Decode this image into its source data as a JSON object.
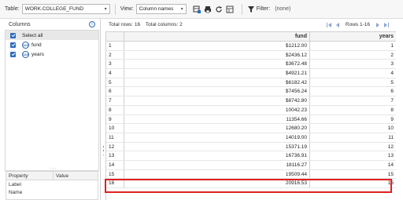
{
  "toolbar": {
    "table_label": "Table:",
    "table_value": "WORK.COLLEGE_FUND",
    "view_label": "View:",
    "view_value": "Column names",
    "filter_label": "Filter:",
    "filter_value": "(none)"
  },
  "columns_panel": {
    "title": "Columns",
    "select_all": "Select all",
    "items": [
      {
        "name": "fund"
      },
      {
        "name": "years"
      }
    ]
  },
  "properties_panel": {
    "col_property": "Property",
    "col_value": "Value",
    "rows": [
      "Label",
      "Name"
    ]
  },
  "grid_info": {
    "total_rows": "Total rows: 16",
    "total_columns": "Total columns: 2",
    "rows_range": "Rows 1-16"
  },
  "grid": {
    "headers": [
      "fund",
      "years"
    ],
    "rows": [
      [
        "1",
        "$1212.00",
        "1"
      ],
      [
        "2",
        "$2436.12",
        "2"
      ],
      [
        "3",
        "$3672.48",
        "3"
      ],
      [
        "4",
        "$4921.21",
        "4"
      ],
      [
        "5",
        "$6182.42",
        "5"
      ],
      [
        "6",
        "$7456.24",
        "6"
      ],
      [
        "7",
        "$8742.80",
        "7"
      ],
      [
        "8",
        "10042.23",
        "8"
      ],
      [
        "9",
        "11354.66",
        "9"
      ],
      [
        "10",
        "12680.20",
        "10"
      ],
      [
        "11",
        "14019.00",
        "11"
      ],
      [
        "12",
        "15371.19",
        "12"
      ],
      [
        "13",
        "16736.91",
        "13"
      ],
      [
        "14",
        "18116.27",
        "14"
      ],
      [
        "15",
        "19509.44",
        "15"
      ],
      [
        "16",
        "20916.53",
        "16"
      ]
    ]
  },
  "colors": {
    "accent": "#2d6cc0",
    "highlight": "#e02020"
  }
}
